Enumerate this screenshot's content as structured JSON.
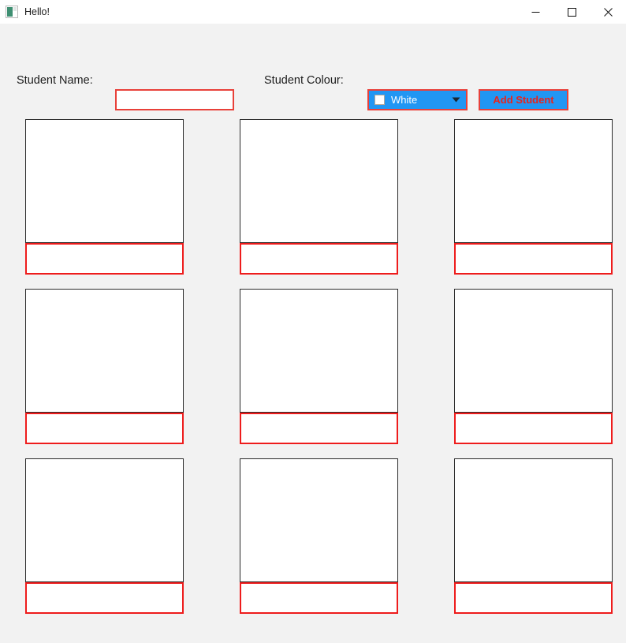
{
  "window": {
    "title": "Hello!",
    "icon": "app-window-icon",
    "background_color": "#f2f2f2",
    "titlebar_color": "#ffffff",
    "controls": {
      "minimize_label": "Minimize",
      "maximize_label": "Maximize",
      "close_label": "Close"
    }
  },
  "form": {
    "name_label": "Student Name:",
    "name_value": "",
    "name_placeholder": "",
    "colour_label": "Student Colour:",
    "colour_selected": "White",
    "colour_swatch_hex": "#ffffff",
    "colour_options": [
      "White"
    ],
    "add_button_label": "Add Student",
    "accent_blue": "#2196f3",
    "accent_red": "#e8413a",
    "button_text_color": "#e8231c"
  },
  "grid": {
    "columns": 3,
    "rows": 3,
    "image_border_color": "#2b2b2b",
    "name_border_color": "#ee1c1c",
    "cards": [
      {
        "name": "",
        "image": ""
      },
      {
        "name": "",
        "image": ""
      },
      {
        "name": "",
        "image": ""
      },
      {
        "name": "",
        "image": ""
      },
      {
        "name": "",
        "image": ""
      },
      {
        "name": "",
        "image": ""
      },
      {
        "name": "",
        "image": ""
      },
      {
        "name": "",
        "image": ""
      },
      {
        "name": "",
        "image": ""
      }
    ]
  }
}
